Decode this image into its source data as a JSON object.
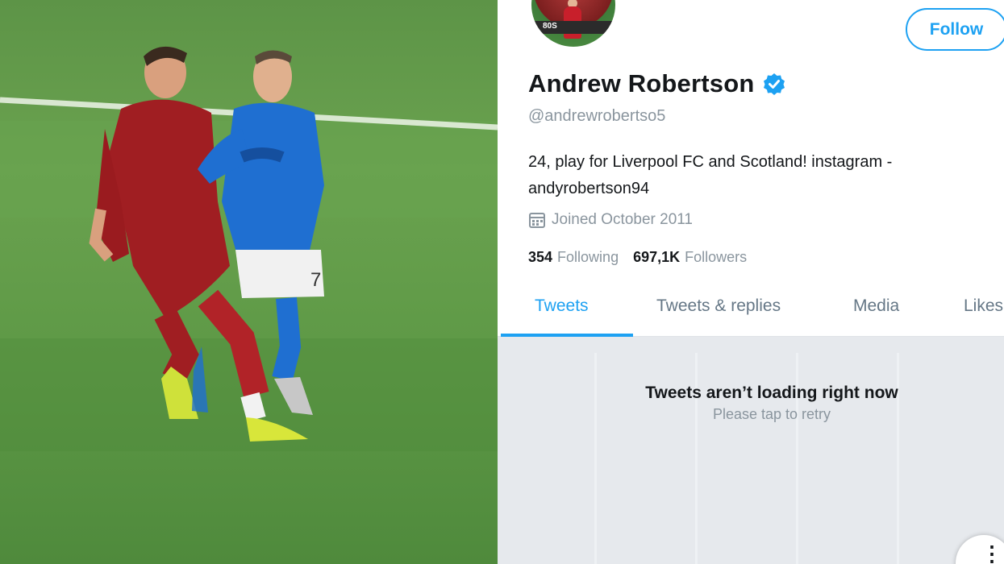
{
  "profile": {
    "name": "Andrew Robertson",
    "handle": "@andrewrobertso5",
    "bio_line1": "24, play for Liverpool FC and Scotland! instagram -",
    "bio_line2": "andyrobertson94",
    "joined": "Joined October 2011",
    "following_count": "354",
    "following_label": "Following",
    "followers_count": "697,1K",
    "followers_label": "Followers",
    "verified": true,
    "avatar_ad_text": "80S"
  },
  "buttons": {
    "follow_label": "Follow"
  },
  "tabs": [
    {
      "label": "Tweets",
      "active": true
    },
    {
      "label": "Tweets & replies",
      "active": false
    },
    {
      "label": "Media",
      "active": false
    },
    {
      "label": "Likes",
      "active": false
    }
  ],
  "feed": {
    "error_title": "Tweets aren’t loading right now",
    "error_subtitle": "Please tap to retry"
  },
  "video": {
    "shirt_number": "7"
  },
  "colors": {
    "accent": "#1da1f2",
    "liverpool_red": "#a01e22",
    "napoli_blue": "#1f6fd1",
    "pitch_green": "#5f9a47"
  }
}
